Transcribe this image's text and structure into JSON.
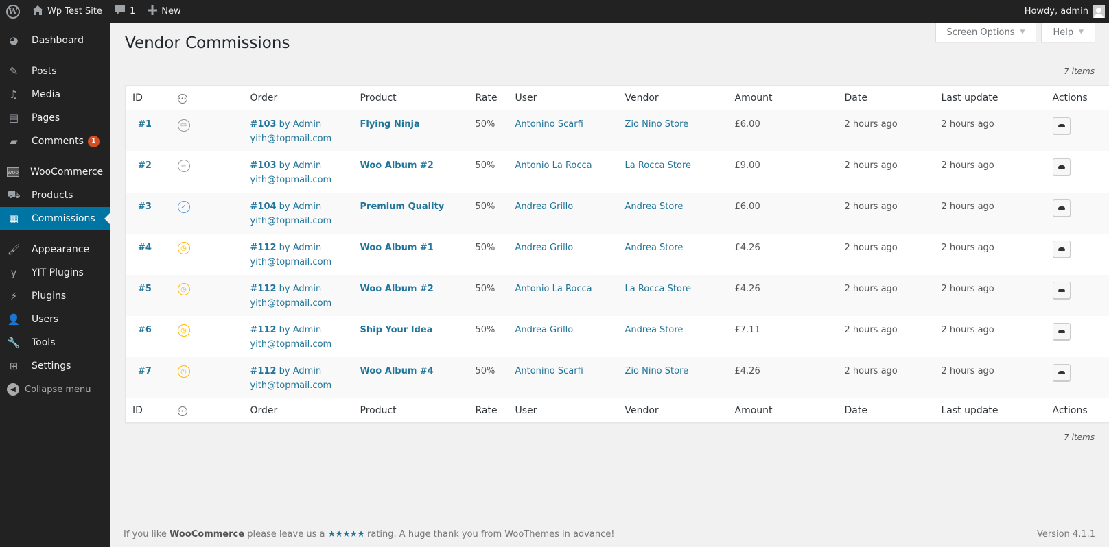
{
  "adminbar": {
    "site_name": "Wp Test Site",
    "comments_count": "1",
    "new_label": "New",
    "howdy": "Howdy, admin"
  },
  "sidebar": {
    "items": [
      {
        "label": "Dashboard",
        "icon": "dashboard-icon"
      },
      {
        "label": "Posts",
        "icon": "pushpin-icon"
      },
      {
        "label": "Media",
        "icon": "media-icon"
      },
      {
        "label": "Pages",
        "icon": "pages-icon"
      },
      {
        "label": "Comments",
        "icon": "comment-icon",
        "badge": "1"
      },
      {
        "label": "WooCommerce",
        "icon": "woocommerce-icon"
      },
      {
        "label": "Products",
        "icon": "cart-icon"
      },
      {
        "label": "Commissions",
        "icon": "commissions-icon",
        "active": true
      },
      {
        "label": "Appearance",
        "icon": "paintbrush-icon"
      },
      {
        "label": "YIT Plugins",
        "icon": "yit-icon"
      },
      {
        "label": "Plugins",
        "icon": "plug-icon"
      },
      {
        "label": "Users",
        "icon": "user-icon"
      },
      {
        "label": "Tools",
        "icon": "wrench-icon"
      },
      {
        "label": "Settings",
        "icon": "sliders-icon"
      }
    ],
    "collapse_label": "Collapse menu"
  },
  "screen_meta": {
    "screen_options": "Screen Options",
    "help": "Help"
  },
  "page": {
    "title": "Vendor Commissions",
    "items_count": "7 items"
  },
  "table": {
    "columns": [
      "ID",
      "status",
      "Order",
      "Product",
      "Rate",
      "User",
      "Vendor",
      "Amount",
      "Date",
      "Last update",
      "Actions"
    ],
    "rows": [
      {
        "id": "#1",
        "status": "processing",
        "order": "#103",
        "by": "by Admin",
        "email": "yith@topmail.com",
        "product": "Flying Ninja",
        "rate": "50%",
        "user": "Antonino Scarfi",
        "vendor": "Zio Nino Store",
        "amount": "£6.00",
        "date": "2 hours ago",
        "last_update": "2 hours ago"
      },
      {
        "id": "#2",
        "status": "refunded",
        "order": "#103",
        "by": "by Admin",
        "email": "yith@topmail.com",
        "product": "Woo Album #2",
        "rate": "50%",
        "user": "Antonio La Rocca",
        "vendor": "La Rocca Store",
        "amount": "£9.00",
        "date": "2 hours ago",
        "last_update": "2 hours ago"
      },
      {
        "id": "#3",
        "status": "paid",
        "order": "#104",
        "by": "by Admin",
        "email": "yith@topmail.com",
        "product": "Premium Quality",
        "rate": "50%",
        "user": "Andrea Grillo",
        "vendor": "Andrea Store",
        "amount": "£6.00",
        "date": "2 hours ago",
        "last_update": "2 hours ago"
      },
      {
        "id": "#4",
        "status": "pending",
        "order": "#112",
        "by": "by Admin",
        "email": "yith@topmail.com",
        "product": "Woo Album #1",
        "rate": "50%",
        "user": "Andrea Grillo",
        "vendor": "Andrea Store",
        "amount": "£4.26",
        "date": "2 hours ago",
        "last_update": "2 hours ago"
      },
      {
        "id": "#5",
        "status": "pending",
        "order": "#112",
        "by": "by Admin",
        "email": "yith@topmail.com",
        "product": "Woo Album #2",
        "rate": "50%",
        "user": "Antonio La Rocca",
        "vendor": "La Rocca Store",
        "amount": "£4.26",
        "date": "2 hours ago",
        "last_update": "2 hours ago"
      },
      {
        "id": "#6",
        "status": "pending",
        "order": "#112",
        "by": "by Admin",
        "email": "yith@topmail.com",
        "product": "Ship Your Idea",
        "rate": "50%",
        "user": "Andrea Grillo",
        "vendor": "Andrea Store",
        "amount": "£7.11",
        "date": "2 hours ago",
        "last_update": "2 hours ago"
      },
      {
        "id": "#7",
        "status": "pending",
        "order": "#112",
        "by": "by Admin",
        "email": "yith@topmail.com",
        "product": "Woo Album #4",
        "rate": "50%",
        "user": "Antonino Scarfi",
        "vendor": "Zio Nino Store",
        "amount": "£4.26",
        "date": "2 hours ago",
        "last_update": "2 hours ago"
      }
    ]
  },
  "footer": {
    "text_before": "If you like",
    "brand": "WooCommerce",
    "text_mid": "please leave us a",
    "stars": "★★★★★",
    "text_after": "rating. A huge thank you from WooThemes in advance!",
    "version": "Version 4.1.1"
  },
  "colors": {
    "accent": "#0074a2",
    "link": "#21759b",
    "pending": "#ffba00",
    "paid": "#5b9dd9",
    "badge": "#d54e21"
  }
}
